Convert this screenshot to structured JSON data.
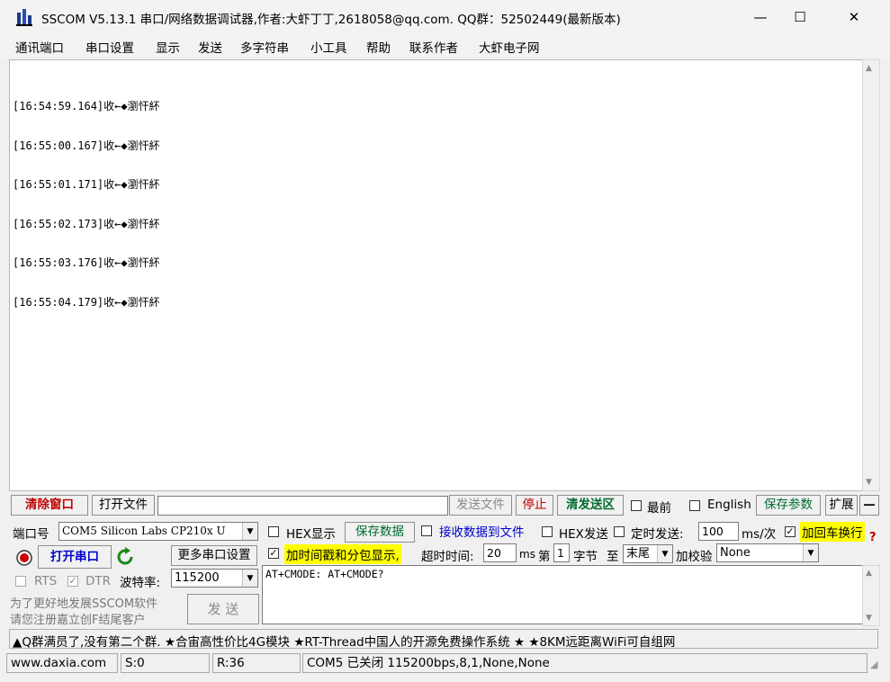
{
  "window": {
    "title": "SSCOM V5.13.1 串口/网络数据调试器,作者:大虾丁丁,2618058@qq.com. QQ群：52502449(最新版本)",
    "minimize": "—",
    "maximize": "☐",
    "close": "✕"
  },
  "menu": [
    "通讯端口",
    "串口设置",
    "显示",
    "发送",
    "多字符串",
    "小工具",
    "帮助",
    "联系作者",
    "大虾电子网"
  ],
  "log": {
    "lines": [
      "[16:54:59.164]收←◆瀏忓紑",
      "[16:55:00.167]收←◆瀏忓紑",
      "[16:55:01.171]收←◆瀏忓紑",
      "[16:55:02.173]收←◆瀏忓紑",
      "[16:55:03.176]收←◆瀏忓紑",
      "[16:55:04.179]收←◆瀏忓紑"
    ]
  },
  "toolbar": {
    "clear_window": "清除窗口",
    "open_file": "打开文件",
    "file_path": "",
    "send_file": "发送文件",
    "stop": "停止",
    "clear_send": "清发送区",
    "front_most": "最前",
    "english": "English",
    "save_params": "保存参数",
    "expand": "扩展",
    "collapse": "—"
  },
  "port": {
    "port_label": "端口号",
    "port_value": "COM5 Silicon Labs CP210x U",
    "open_port": "打开串口",
    "more_settings": "更多串口设置",
    "rts": "RTS",
    "dtr": "DTR",
    "baud_label": "波特率:",
    "baud_value": "115200"
  },
  "display": {
    "hex_display": "HEX显示",
    "save_data": "保存数据",
    "recv_to_file": "接收数据到文件",
    "hex_send": "HEX发送",
    "timed_send": "定时发送:",
    "period_value": "100",
    "period_unit": "ms/次",
    "add_crlf": "加回车换行",
    "help": "?",
    "timestamp": "加时间戳和分包显示,",
    "timeout_label": "超时时间:",
    "timeout_value": "20",
    "timeout_unit": "ms",
    "byte_from_label": "第",
    "byte_from_value": "1",
    "byte_unit": "字节",
    "to_label": "至",
    "to_value": "末尾",
    "checksum_label": "加校验",
    "checksum_value": "None"
  },
  "send": {
    "text": "AT+CMODE: AT+CMODE?",
    "button": "发 送",
    "promo_line1": "为了更好地发展SSCOM软件",
    "promo_line2": "请您注册嘉立创F结尾客户"
  },
  "ticker": "▲Q群满员了,没有第二个群. ★合宙高性价比4G模块 ★RT-Thread中国人的开源免费操作系统 ★ ★8KM远距离WiFi可自组网",
  "statusbar": {
    "website": "www.daxia.com",
    "sent": "S:0",
    "received": "R:36",
    "port_state": "COM5 已关闭  115200bps,8,1,None,None"
  }
}
